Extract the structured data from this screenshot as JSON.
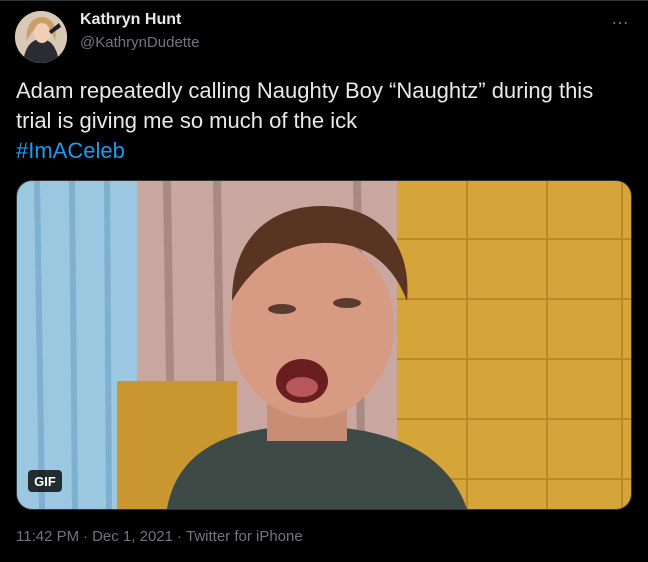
{
  "author": {
    "name": "Kathryn Hunt",
    "handle": "@KathrynDudette",
    "avatar_icon": "profile-photo"
  },
  "more_icon": "…",
  "tweet": {
    "text": "Adam repeatedly calling Naughty Boy “Naughtz” during this trial is giving me so much of the ick",
    "hashtag": "#ImACeleb"
  },
  "media": {
    "badge": "GIF"
  },
  "meta": {
    "time": "11:42 PM",
    "separator1": "·",
    "date": "Dec 1, 2021",
    "separator2": "·",
    "source": "Twitter for iPhone"
  },
  "colors": {
    "background": "#000000",
    "text": "#e7e9ea",
    "secondary": "#71767b",
    "link": "#1d9bf0"
  }
}
